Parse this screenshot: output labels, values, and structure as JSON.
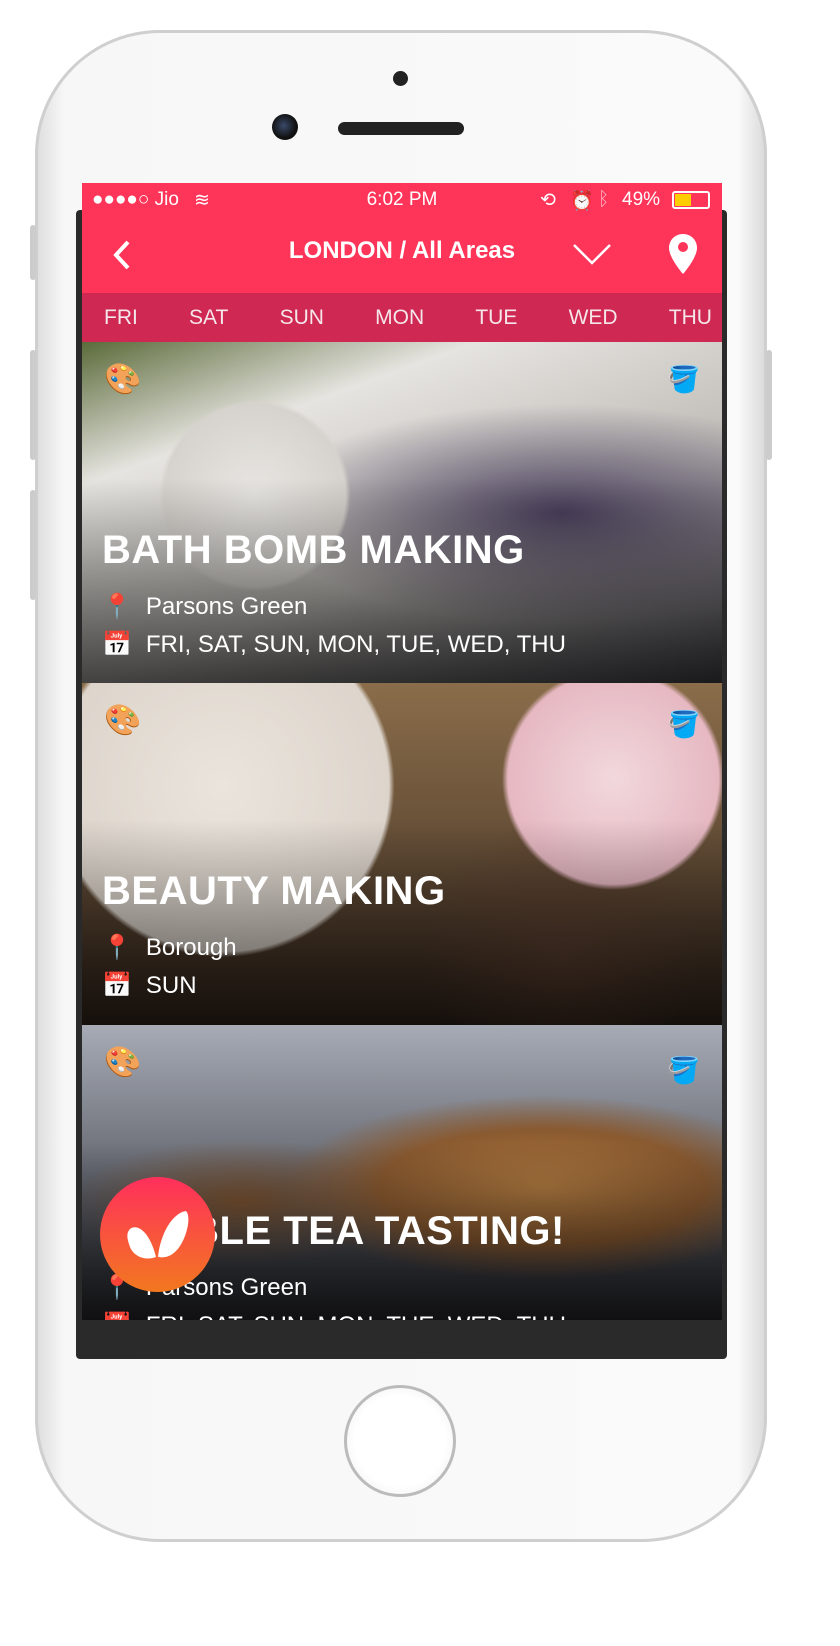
{
  "status_bar": {
    "carrier": "●●●●○ Jio",
    "time": "6:02 PM",
    "battery": "49%",
    "battery_level": 0.49,
    "icons": [
      "wifi-icon",
      "rotation-lock-icon",
      "alarm-icon",
      "bluetooth-icon",
      "battery-icon"
    ]
  },
  "header": {
    "title": "LONDON / All Areas",
    "icons": [
      "back-chevron-icon",
      "dropdown-chevron-icon",
      "location-pin-icon"
    ]
  },
  "accent_color": "#ff3459",
  "days": [
    "FRI",
    "SAT",
    "SUN",
    "MON",
    "TUE",
    "WED",
    "THU"
  ],
  "events": [
    {
      "title": "BATH BOMB MAKING",
      "location": "Parsons Green",
      "days": "FRI, SAT, SUN, MON, TUE, WED, THU"
    },
    {
      "title": "BEAUTY MAKING",
      "location": "Borough",
      "days": "SUN"
    },
    {
      "title": "BUBBLE TEA TASTING!",
      "location": "Parsons Green",
      "days": "FRI, SAT, SUN, MON, TUE, WED, THU"
    }
  ]
}
